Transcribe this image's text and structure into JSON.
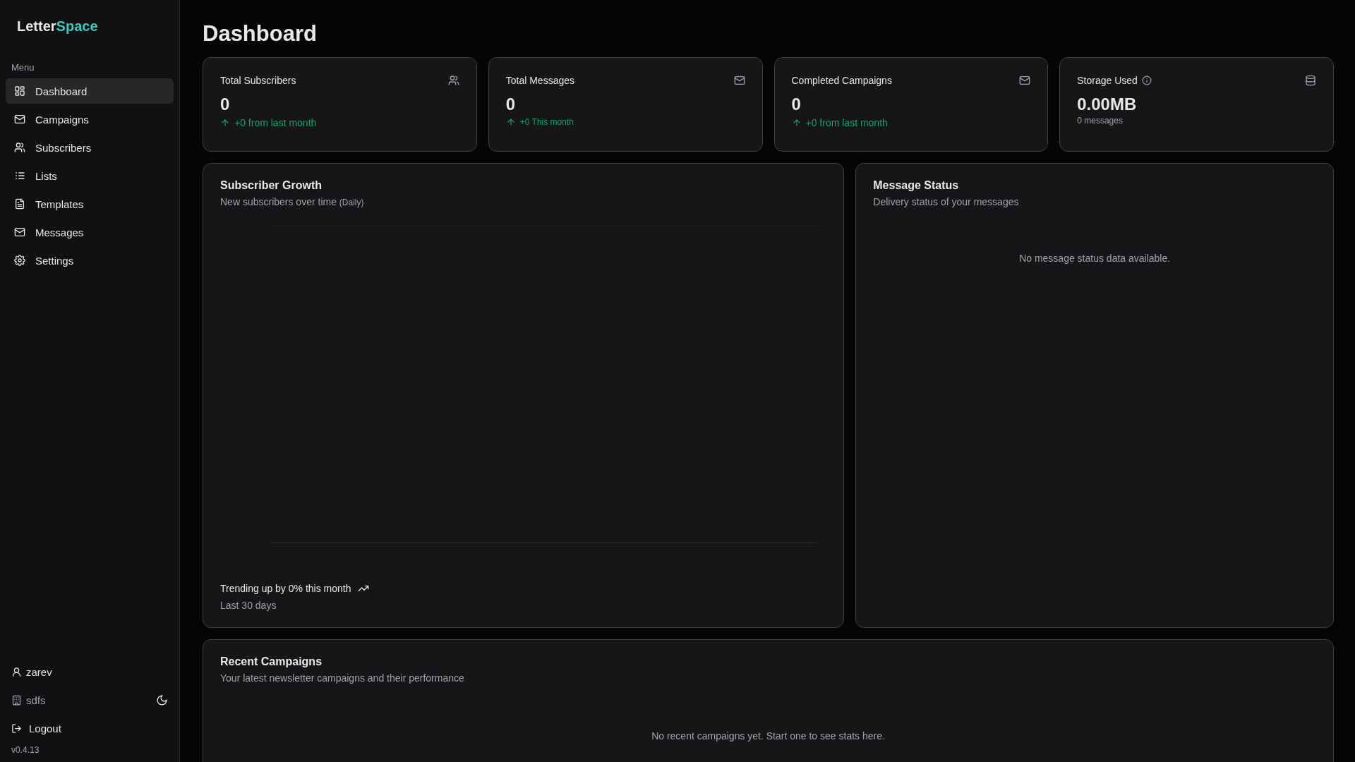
{
  "brand": {
    "first": "Letter",
    "second": "Space"
  },
  "sidebar": {
    "section_label": "Menu",
    "items": [
      {
        "kind": "dashboard",
        "label": "Dashboard",
        "selected": true
      },
      {
        "kind": "campaigns",
        "label": "Campaigns",
        "selected": false
      },
      {
        "kind": "subscribers",
        "label": "Subscribers",
        "selected": false
      },
      {
        "kind": "lists",
        "label": "Lists",
        "selected": false
      },
      {
        "kind": "templates",
        "label": "Templates",
        "selected": false
      },
      {
        "kind": "messages",
        "label": "Messages",
        "selected": false
      },
      {
        "kind": "settings",
        "label": "Settings",
        "selected": false
      }
    ],
    "user": "zarev",
    "organization": "sdfs",
    "logout": "Logout",
    "version": "v0.4.13"
  },
  "page_title": "Dashboard",
  "stat_cards": [
    {
      "kind": "subscribers",
      "title": "Total Subscribers",
      "value": "0",
      "trend": "+0 from last month"
    },
    {
      "kind": "messages",
      "title": "Total Messages",
      "value": "0",
      "trend": "+0 This month"
    },
    {
      "kind": "campaigns",
      "title": "Completed Campaigns",
      "value": "0",
      "trend": "+0 from last month"
    },
    {
      "kind": "storage",
      "title": "Storage Used",
      "value": "0.00MB",
      "note": "0 messages"
    }
  ],
  "subscriber_growth": {
    "title": "Subscriber Growth",
    "subtitle": "New subscribers over time",
    "period": "(Daily)",
    "trend": "Trending up by 0% this month",
    "range": "Last 30 days"
  },
  "message_status": {
    "title": "Message Status",
    "subtitle": "Delivery status of your messages",
    "empty": "No message status data available."
  },
  "recent_campaigns": {
    "title": "Recent Campaigns",
    "subtitle": "Your latest newsletter campaigns and their performance",
    "empty": "No recent campaigns yet. Start one to see stats here."
  }
}
